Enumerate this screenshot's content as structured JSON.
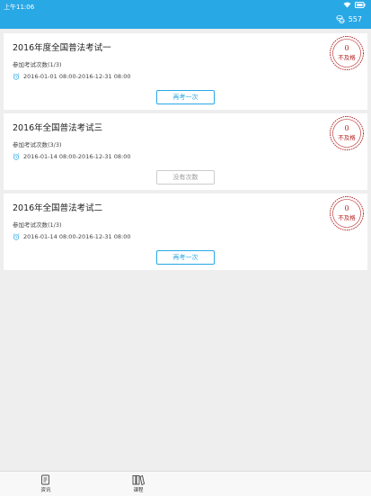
{
  "status": {
    "time": "上午11:06"
  },
  "header": {
    "coins": "557"
  },
  "exams": [
    {
      "title": "2016年度全国普法考试一",
      "attempts": "参加考试次数(1/3)",
      "dates": "2016-01-01 08:00-2016-12-31 08:00",
      "button": "再考一次",
      "button_enabled": true,
      "stamp": {
        "score": "0",
        "status": "不及格"
      }
    },
    {
      "title": "2016年全国普法考试三",
      "attempts": "参加考试次数(3/3)",
      "dates": "2016-01-14 08:00-2016-12-31 08:00",
      "button": "没有次数",
      "button_enabled": false,
      "stamp": {
        "score": "0",
        "status": "不及格"
      }
    },
    {
      "title": "2016年全国普法考试二",
      "attempts": "参加考试次数(1/3)",
      "dates": "2016-01-14 08:00-2016-12-31 08:00",
      "button": "再考一次",
      "button_enabled": true,
      "stamp": {
        "score": "0",
        "status": "不及格"
      }
    }
  ],
  "tabs": [
    {
      "label": "资讯"
    },
    {
      "label": "课程"
    }
  ],
  "colors": {
    "primary": "#29a8e6",
    "stamp": "#b22222",
    "background": "#eeeeee"
  }
}
